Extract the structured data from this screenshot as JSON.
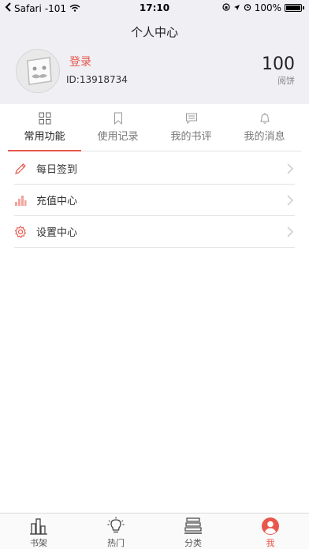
{
  "status_bar": {
    "carrier": "Safari",
    "signal": "-101",
    "time": "17:10",
    "battery": "100%"
  },
  "header": {
    "title": "个人中心"
  },
  "profile": {
    "login_label": "登录",
    "user_id": "ID:13918734",
    "coin_value": "100",
    "coin_unit": "阅饼"
  },
  "tabs": [
    {
      "label": "常用功能",
      "icon": "grid-icon",
      "active": true
    },
    {
      "label": "使用记录",
      "icon": "bookmark-icon",
      "active": false
    },
    {
      "label": "我的书评",
      "icon": "comment-icon",
      "active": false
    },
    {
      "label": "我的消息",
      "icon": "bell-icon",
      "active": false
    }
  ],
  "menu": [
    {
      "label": "每日签到",
      "icon": "pencil-icon"
    },
    {
      "label": "充值中心",
      "icon": "coins-icon"
    },
    {
      "label": "设置中心",
      "icon": "gear-icon"
    }
  ],
  "tabbar": [
    {
      "label": "书架",
      "icon": "bookshelf-icon",
      "active": false
    },
    {
      "label": "热门",
      "icon": "lightbulb-icon",
      "active": false
    },
    {
      "label": "分类",
      "icon": "category-icon",
      "active": false
    },
    {
      "label": "我",
      "icon": "profile-icon",
      "active": true
    }
  ],
  "colors": {
    "accent": "#e8574c",
    "header_bg": "#efeff4"
  }
}
